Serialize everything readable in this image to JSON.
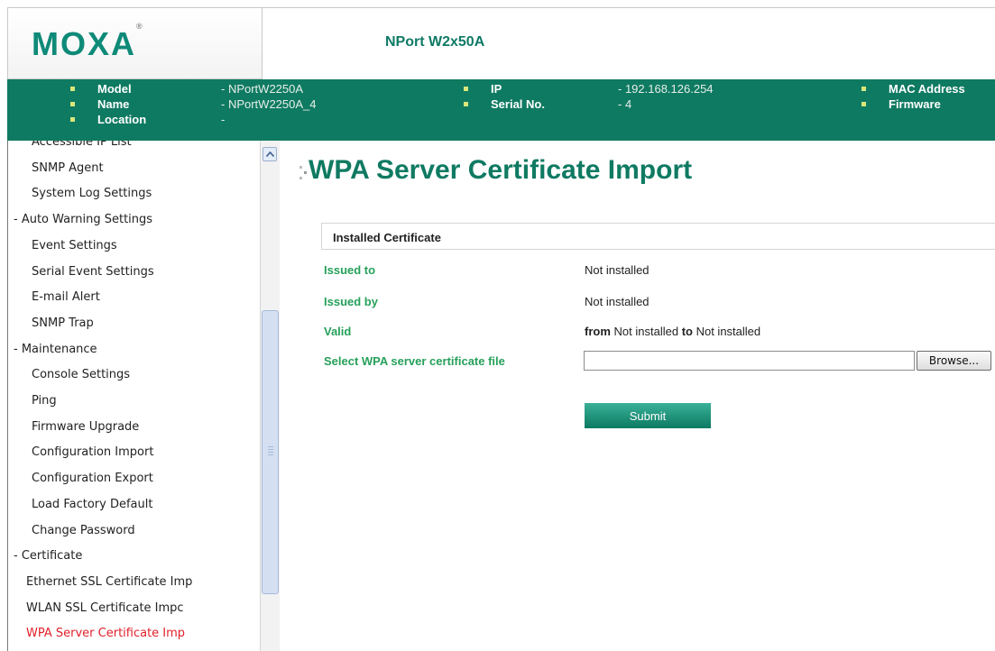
{
  "header": {
    "logo": "MOXA",
    "logo_mark": "®",
    "product": "NPort W2x50A"
  },
  "info": {
    "model_label": "Model",
    "model_value": "- NPortW2250A",
    "name_label": "Name",
    "name_value": "- NPortW2250A_4",
    "location_label": "Location",
    "location_value": "-",
    "ip_label": "IP",
    "ip_value": "- 192.168.126.254",
    "serial_label": "Serial No.",
    "serial_value": "- 4",
    "mac_label": "MAC Address",
    "firmware_label": "Firmware"
  },
  "sidebar": {
    "items": [
      {
        "label": "Accessible IP List",
        "indent": 2
      },
      {
        "label": "SNMP Agent",
        "indent": 2
      },
      {
        "label": "System Log Settings",
        "indent": 2
      },
      {
        "label": "- Auto Warning Settings",
        "indent": 1
      },
      {
        "label": "Event Settings",
        "indent": 2
      },
      {
        "label": "Serial Event Settings",
        "indent": 2
      },
      {
        "label": "E-mail Alert",
        "indent": 2
      },
      {
        "label": "SNMP Trap",
        "indent": 2
      },
      {
        "label": "- Maintenance",
        "indent": 1
      },
      {
        "label": "Console Settings",
        "indent": 2
      },
      {
        "label": "Ping",
        "indent": 2
      },
      {
        "label": "Firmware Upgrade",
        "indent": 2
      },
      {
        "label": "Configuration Import",
        "indent": 2
      },
      {
        "label": "Configuration Export",
        "indent": 2
      },
      {
        "label": "Load Factory Default",
        "indent": 2
      },
      {
        "label": "Change Password",
        "indent": 2
      },
      {
        "label": "- Certificate",
        "indent": 1
      },
      {
        "label": "Ethernet SSL Certificate Imp",
        "indent": 3
      },
      {
        "label": "WLAN SSL Certificate Impc",
        "indent": 3
      },
      {
        "label": "WPA Server Certificate Imp",
        "indent": 3,
        "active": true
      }
    ]
  },
  "main": {
    "title": "WPA Server Certificate Import",
    "section_title": "Installed Certificate",
    "issued_to_label": "Issued to",
    "issued_to_value": "Not installed",
    "issued_by_label": "Issued by",
    "issued_by_value": "Not installed",
    "valid_label": "Valid",
    "valid_from_word": "from",
    "valid_from_value": "Not installed",
    "valid_to_word": "to",
    "valid_to_value": "Not installed",
    "select_label": "Select WPA server certificate file",
    "file_value": "",
    "browse_label": "Browse...",
    "submit_label": "Submit"
  },
  "colors": {
    "brand": "#0f7a62",
    "label_green": "#26a05a",
    "active_nav": "#e0202a"
  }
}
